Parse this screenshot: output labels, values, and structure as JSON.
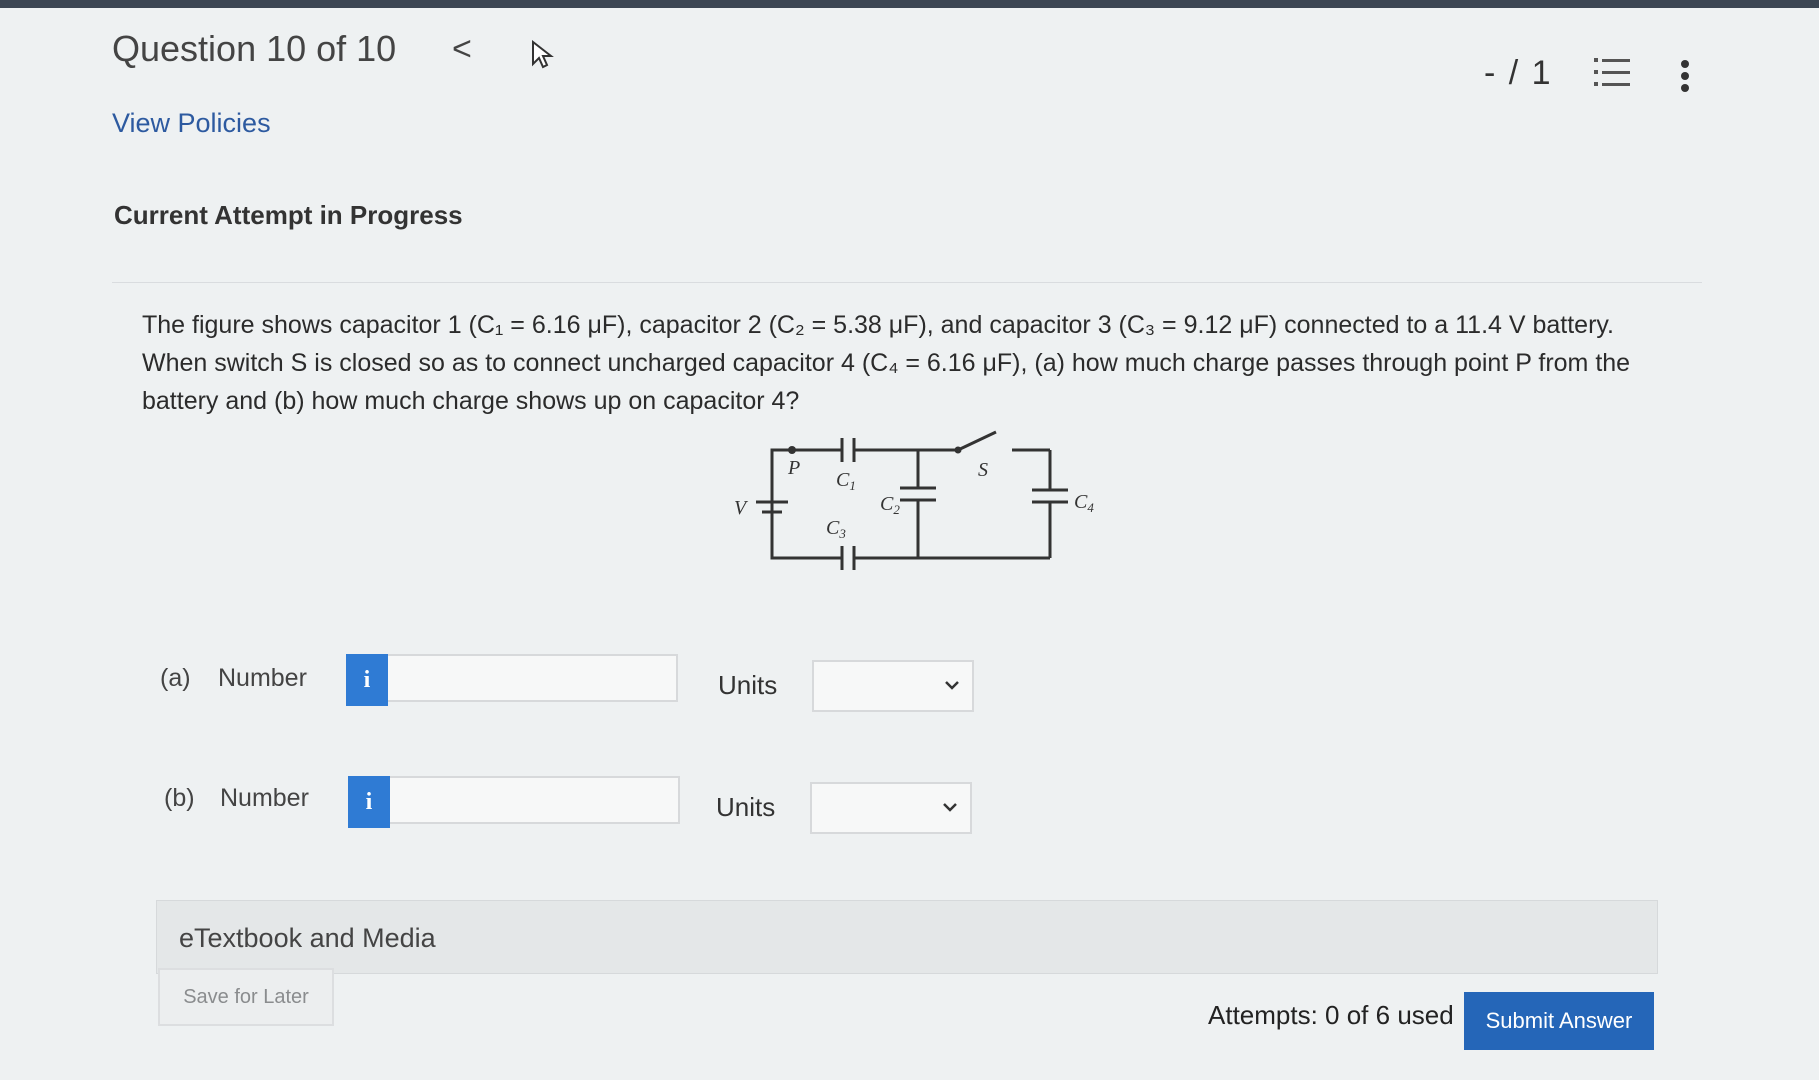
{
  "header": {
    "question_counter": "Question 10 of 10",
    "prev_glyph": "<",
    "score": "- / 1"
  },
  "links": {
    "view_policies": "View Policies"
  },
  "attempt_status": "Current Attempt in Progress",
  "question": {
    "line1": "The figure shows capacitor 1 (C₁ = 6.16 μF), capacitor 2 (C₂ = 5.38 μF), and capacitor 3 (C₃ = 9.12 μF) connected to a 11.4 V battery.",
    "line2": "When switch S is closed so as to connect uncharged capacitor 4 (C₄ = 6.16 μF), (a) how much charge passes through point P from the",
    "line3": "battery and (b) how much charge shows up on capacitor 4?"
  },
  "circuit_labels": {
    "p": "P",
    "v": "V",
    "s": "S",
    "c1": "C",
    "c1_sub": "1",
    "c2": "C",
    "c2_sub": "2",
    "c3": "C",
    "c3_sub": "3",
    "c4": "C",
    "c4_sub": "4"
  },
  "answers": [
    {
      "part": "(a)",
      "label": "Number",
      "info_glyph": "i",
      "value": "",
      "units_label": "Units",
      "units_selected": ""
    },
    {
      "part": "(b)",
      "label": "Number",
      "info_glyph": "i",
      "value": "",
      "units_label": "Units",
      "units_selected": ""
    }
  ],
  "etextbook": "eTextbook and Media",
  "footer": {
    "save_label": "Save for Later",
    "attempts": "Attempts: 0 of 6 used",
    "submit_label": "Submit Answer"
  },
  "colors": {
    "accent": "#2566b8",
    "info": "#2f7bd4",
    "link": "#2d5aa0"
  }
}
